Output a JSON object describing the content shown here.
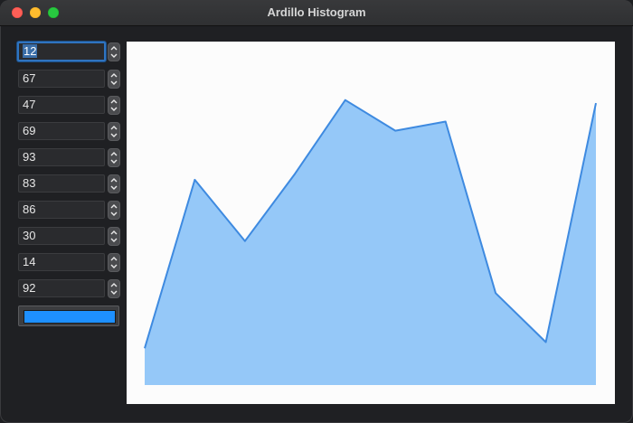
{
  "window": {
    "title": "Ardillo Histogram"
  },
  "inputs": {
    "values": [
      "12",
      "67",
      "47",
      "69",
      "93",
      "83",
      "86",
      "30",
      "14",
      "92"
    ]
  },
  "color_well": {
    "color": "#1e90ff"
  },
  "chart_data": {
    "type": "area",
    "x": [
      1,
      2,
      3,
      4,
      5,
      6,
      7,
      8,
      9,
      10
    ],
    "values": [
      12,
      67,
      47,
      69,
      93,
      83,
      86,
      30,
      14,
      92
    ],
    "ylim": [
      0,
      100
    ],
    "fill_color": "#95c8f8",
    "line_color": "#3e8ae0",
    "grid": false,
    "title": "",
    "xlabel": "",
    "ylabel": ""
  }
}
